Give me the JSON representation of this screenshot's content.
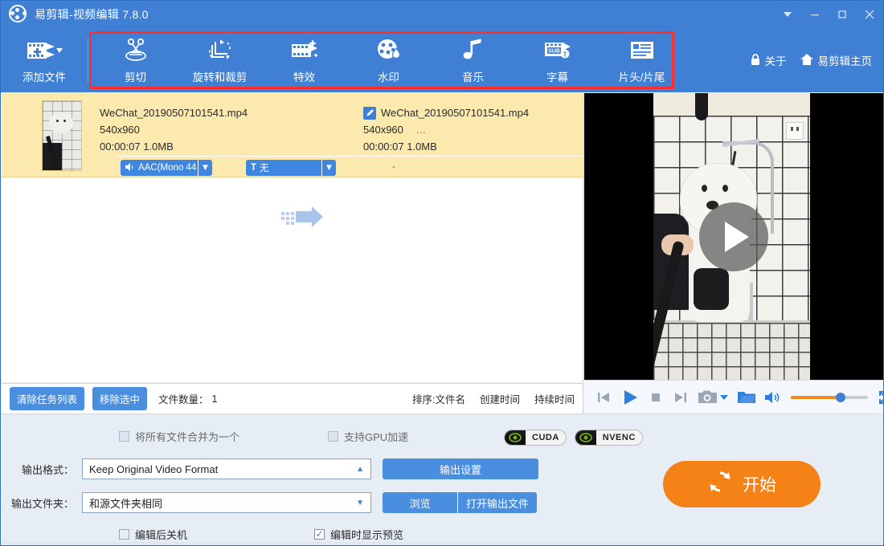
{
  "window": {
    "title": "易剪辑-视频编辑 7.8.0",
    "logo_icon": "film-reel-icon",
    "controls": [
      {
        "name": "dropdown-menu-button",
        "icon": "chevron-down-icon"
      },
      {
        "name": "minimize-button",
        "icon": "minimize-icon"
      },
      {
        "name": "maximize-button",
        "icon": "maximize-icon"
      },
      {
        "name": "close-button",
        "icon": "close-icon"
      }
    ]
  },
  "toolbar": {
    "add_file": {
      "label": "添加文件",
      "icon": "add-film-icon",
      "caret": "▾"
    },
    "tools": [
      {
        "label": "剪切",
        "icon": "scissors-icon"
      },
      {
        "label": "旋转和裁剪",
        "icon": "rotate-crop-icon"
      },
      {
        "label": "特效",
        "icon": "effects-film-icon"
      },
      {
        "label": "水印",
        "icon": "watermark-icon"
      },
      {
        "label": "音乐",
        "icon": "music-note-icon"
      },
      {
        "label": "字幕",
        "icon": "subtitle-icon"
      },
      {
        "label": "片头/片尾",
        "icon": "intro-outro-icon"
      }
    ],
    "highlight_color": "#fb2f2f",
    "right_items": [
      {
        "label": "关于",
        "icon": "lock-icon"
      },
      {
        "label": "易剪辑主页",
        "icon": "home-icon"
      }
    ]
  },
  "file_row": {
    "thumbnail_icon": "video-thumbnail",
    "source": {
      "filename": "WeChat_20190507101541.mp4",
      "resolution": "540x960",
      "duration_size": "00:00:07  1.0MB"
    },
    "output": {
      "badge_icon": "edit-pencil-icon",
      "filename": "WeChat_20190507101541.mp4",
      "resolution": "540x960",
      "ellipsis": "…",
      "duration_size": "00:00:07  1.0MB",
      "placeholder": "-"
    },
    "arrow_icon": "convert-arrow-icon",
    "audio_track": {
      "label": "AAC(Mono 44",
      "icon": "speaker-icon",
      "caret": "▼"
    },
    "subtitle_track": {
      "label": "无",
      "icon": "text-t-icon",
      "caret": "▼"
    }
  },
  "list_toolbar": {
    "clear_list_label": "清除任务列表",
    "remove_selected_label": "移除选中",
    "file_count_label": "文件数量：",
    "file_count_value": "1",
    "sort_prefix": "排序:",
    "sort_options": [
      "文件名",
      "创建时间",
      "持续时间"
    ]
  },
  "preview": {
    "play_icon": "play-overlay-icon",
    "controls": [
      {
        "name": "previous-button",
        "icon": "skip-previous-icon"
      },
      {
        "name": "play-button",
        "icon": "play-icon"
      },
      {
        "name": "stop-button",
        "icon": "stop-icon"
      },
      {
        "name": "next-button",
        "icon": "skip-next-icon"
      },
      {
        "name": "snapshot-button",
        "icon": "camera-icon"
      },
      {
        "name": "snapshot-dropdown",
        "icon": "chevron-down-icon"
      },
      {
        "name": "open-folder-button",
        "icon": "folder-icon"
      },
      {
        "name": "volume-button",
        "icon": "speaker-icon"
      },
      {
        "name": "fullscreen-button",
        "icon": "fullscreen-icon"
      }
    ],
    "volume_percent": 60
  },
  "bottom": {
    "merge_all_label": "将所有文件合并为一个",
    "merge_all_checked": false,
    "gpu_label": "支持GPU加速",
    "gpu_checked": false,
    "badges": [
      {
        "label": "CUDA",
        "icon": "nvidia-eye-icon"
      },
      {
        "label": "NVENC",
        "icon": "nvidia-eye-icon"
      }
    ],
    "output_format_label": "输出格式：",
    "output_format_value": "Keep Original Video Format",
    "output_format_caret": "▲",
    "output_settings_label": "输出设置",
    "output_folder_label": "输出文件夹：",
    "output_folder_value": "和源文件夹相同",
    "output_folder_caret": "▼",
    "browse_label": "浏览",
    "open_output_label": "打开输出文件",
    "shutdown_label": "编辑后关机",
    "shutdown_checked": false,
    "preview_label": "编辑时显示预览",
    "preview_checked": true,
    "start_label": "开始",
    "start_icon": "refresh-circle-icon",
    "start_color": "#f58216"
  }
}
